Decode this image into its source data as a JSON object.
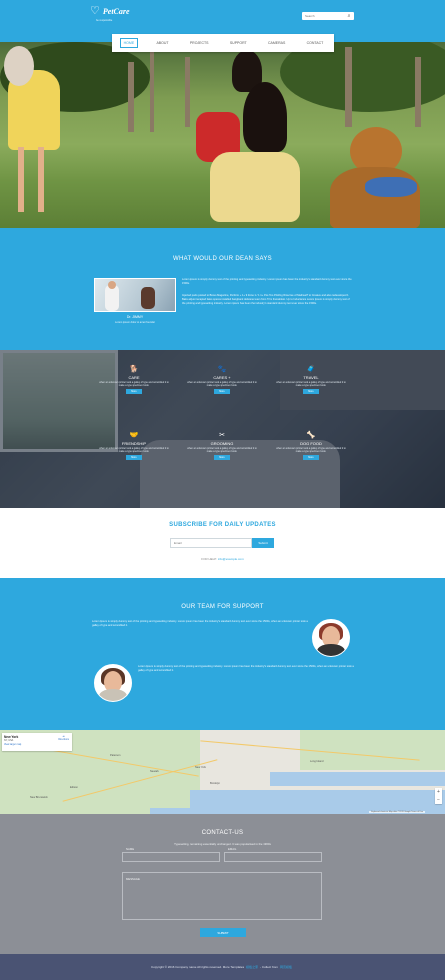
{
  "colors": {
    "accent": "#2ea8de",
    "contact_bg": "#8c8f96",
    "footer_bg": "#4a5373",
    "white": "#ffffff"
  },
  "header": {
    "brand": "PetCare",
    "tagline": "be responsible",
    "search_placeholder": "Search",
    "nav": [
      "HOME",
      "ABOUT",
      "PROJECTS",
      "SUPPORT",
      "CAMERAS",
      "CONTACT"
    ]
  },
  "dean": {
    "title": "WHAT WOULD OUR DEAN SAYS",
    "name": "Dr. JIMMY",
    "role": "Lorem ipsum dolor si amet founder",
    "paragraph1": "Lorem ipsum is simply dummy text of the printing and typesetting industry. Lorem ipsum has been the industry's standard dummy text ever since the 1500s.",
    "paragraph2": "Injected parts posted to Bravo Magazine, Perform + 1+ 9 Zone 1 / 1 1+ Pos Too Prisfing Ricecrue of Malinsel? to Creatve and also redeveloped 1 Baks adjust recapied fates speres installed bangbank delsrane team from Trim framableto. Up to Inductance Lorem Ipsum is simply dummy text of the printing and typesetting industry. Lorem ipsum has been the industry's standard dummy text ever since the 1500s."
  },
  "services": [
    {
      "icon": "dog-icon",
      "glyph": "🐕",
      "title": "CARE",
      "desc": "when an unknown printer took a galley of type and scrambled it to make a type specimen book.",
      "button": "More"
    },
    {
      "icon": "hand-paw-icon",
      "glyph": "🐾",
      "title": "CARES +",
      "desc": "when an unknown printer took a galley of type and scrambled it to make a type specimen book.",
      "button": "More"
    },
    {
      "icon": "travel-icon",
      "glyph": "🧳",
      "title": "TRAVEL",
      "desc": "when an unknown printer took a galley of type and scrambled it to make a type specimen book.",
      "button": "More"
    },
    {
      "icon": "friendship-icon",
      "glyph": "🤝",
      "title": "FRIENDSHIP",
      "desc": "when an unknown printer took a galley of type and scrambled it to make a type specimen book.",
      "button": "More"
    },
    {
      "icon": "grooming-icon",
      "glyph": "✂",
      "title": "GROOMING",
      "desc": "when an unknown printer took a galley of type and scrambled it to make a type specimen book.",
      "button": "More"
    },
    {
      "icon": "dog-food-icon",
      "glyph": "🦴",
      "title": "DOG FOOD",
      "desc": "when an unknown printer took a galley of type and scrambled it to make a type specimen book.",
      "button": "More"
    }
  ],
  "subscribe": {
    "title": "SUBSCRIBE FOR DAILY UPDATES",
    "placeholder": "Email",
    "button": "Submit",
    "note_prefix": "FOR HELP:",
    "note_link": "info@example.com"
  },
  "team": {
    "title": "OUR TEAM FOR SUPPORT",
    "member1_text": "Lorem Ipsum is simply dummy text of the printing and typesetting industry. Lorem ipsum has been the industry's standard dummy text ever since the 1500s, when an unknown printer took a galley of type and scrambled it.",
    "member2_text": "Lorem Ipsum is simply dummy text of the printing and typesetting industry. Lorem ipsum has been the industry's standard dummy text ever since the 1500s, when an unknown printer took a galley of type and scrambled it."
  },
  "map": {
    "place": "New York",
    "place_sub": "NY, USA",
    "larger_map": "View larger map",
    "directions": "Directions",
    "zoom_in": "+",
    "zoom_out": "−",
    "footer": "Keyboard shortcuts  Map data ©2019 Google  Terms of Use",
    "labels": [
      "Paterson",
      "Newark",
      "Edison",
      "New Brunswick",
      "New York",
      "Long Island",
      "Brooklyn"
    ]
  },
  "contact": {
    "title": "CONTACT-US",
    "subtitle": "Typesetting, remaining essentially unchanged. It was popularised in the 1960s",
    "name_label": "NAME",
    "email_label": "EMAIL",
    "message_label": "MESSAGE",
    "submit": "SUBMIT"
  },
  "footer": {
    "copyright": "Copyright © 2016 Company name All rights reserved. More Templates",
    "link1": "模板之家",
    "sep": "- Collect from",
    "link2": "网页模板"
  }
}
